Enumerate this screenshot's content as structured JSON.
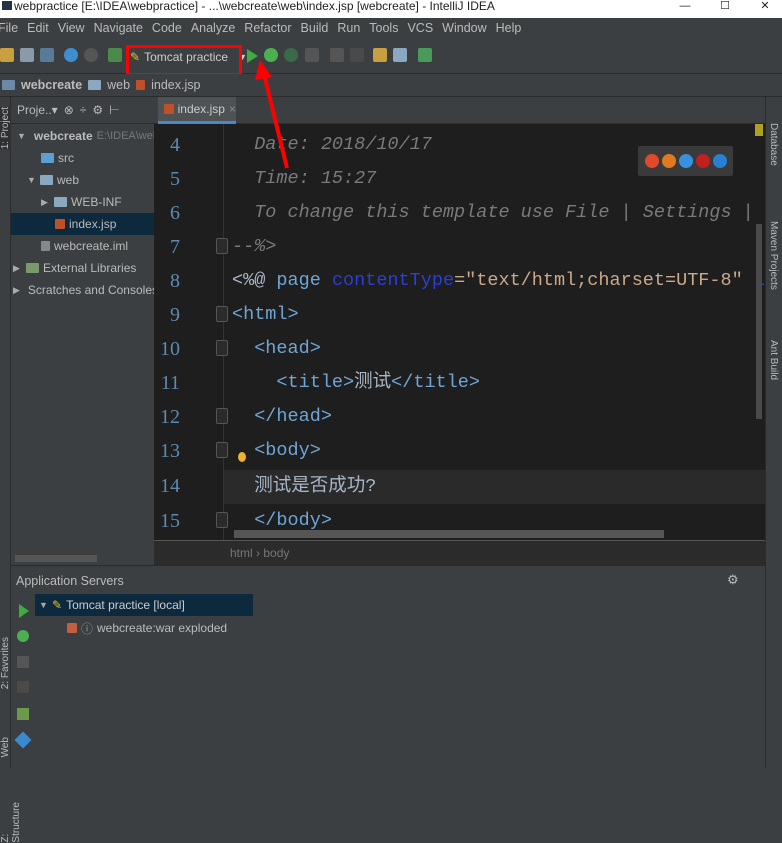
{
  "window": {
    "title": "webpractice [E:\\IDEA\\webpractice] - ...\\webcreate\\web\\index.jsp [webcreate] - IntelliJ IDEA",
    "minimize": "—",
    "maximize": "☐",
    "close": "✕"
  },
  "menu": [
    "File",
    "Edit",
    "View",
    "Navigate",
    "Code",
    "Analyze",
    "Refactor",
    "Build",
    "Run",
    "Tools",
    "VCS",
    "Window",
    "Help"
  ],
  "toolbar": {
    "run_config": "Tomcat practice",
    "dropdown": "▼",
    "highlight_color": "#ff0000"
  },
  "navbar": [
    "webcreate",
    "web",
    "index.jsp"
  ],
  "left_stripe": {
    "project": "1: Project",
    "favorites": "2: Favorites",
    "web": "Web",
    "structure": "Z: Structure"
  },
  "project": {
    "header": "Proje..▾",
    "tree": [
      {
        "label": "webcreate",
        "path": "E:\\IDEA\\web",
        "expanded": "▼"
      },
      {
        "label": "src"
      },
      {
        "label": "web",
        "expanded": "▼"
      },
      {
        "label": "WEB-INF",
        "expanded": "▶"
      },
      {
        "label": "index.jsp",
        "selected": true
      },
      {
        "label": "webcreate.iml"
      },
      {
        "label": "External Libraries",
        "expanded": "▶"
      },
      {
        "label": "Scratches and Consoles",
        "expanded": "▶"
      }
    ]
  },
  "editor": {
    "tab": "index.jsp",
    "tab_close": "×",
    "line_numbers": [
      "4",
      "5",
      "6",
      "7",
      "8",
      "9",
      "10",
      "11",
      "12",
      "13",
      "14",
      "15"
    ],
    "lines": {
      "l4": "  Date: 2018/10/17",
      "l5": "  Time: 15:27",
      "l6": "  To change this template use File | Settings | File Templates.",
      "l7a": "--%>",
      "l8a": "<%@ ",
      "l8b": "page ",
      "l8c": "contentType",
      "l8d": "=\"text/html;charset=UTF-8\" ",
      "l8e": "language",
      "l8f": "=\"",
      "l9": "<html>",
      "l10": "  <head>",
      "l11a": "    <title>",
      "l11b": "测试",
      "l11c": "</title>",
      "l12": "  </head>",
      "l13": "  <body>",
      "l14": "  测试是否成功?",
      "l15": "  </body>"
    },
    "breadcrumbs": [
      "html",
      "body"
    ],
    "breadcrumb_sep": "›"
  },
  "right_stripe": [
    "Database",
    "Maven Projects",
    "Ant Build"
  ],
  "bottom": {
    "title": "Application Servers",
    "gear": "⚙",
    "server": "Tomcat practice [local]",
    "artifact": "webcreate:war exploded"
  }
}
